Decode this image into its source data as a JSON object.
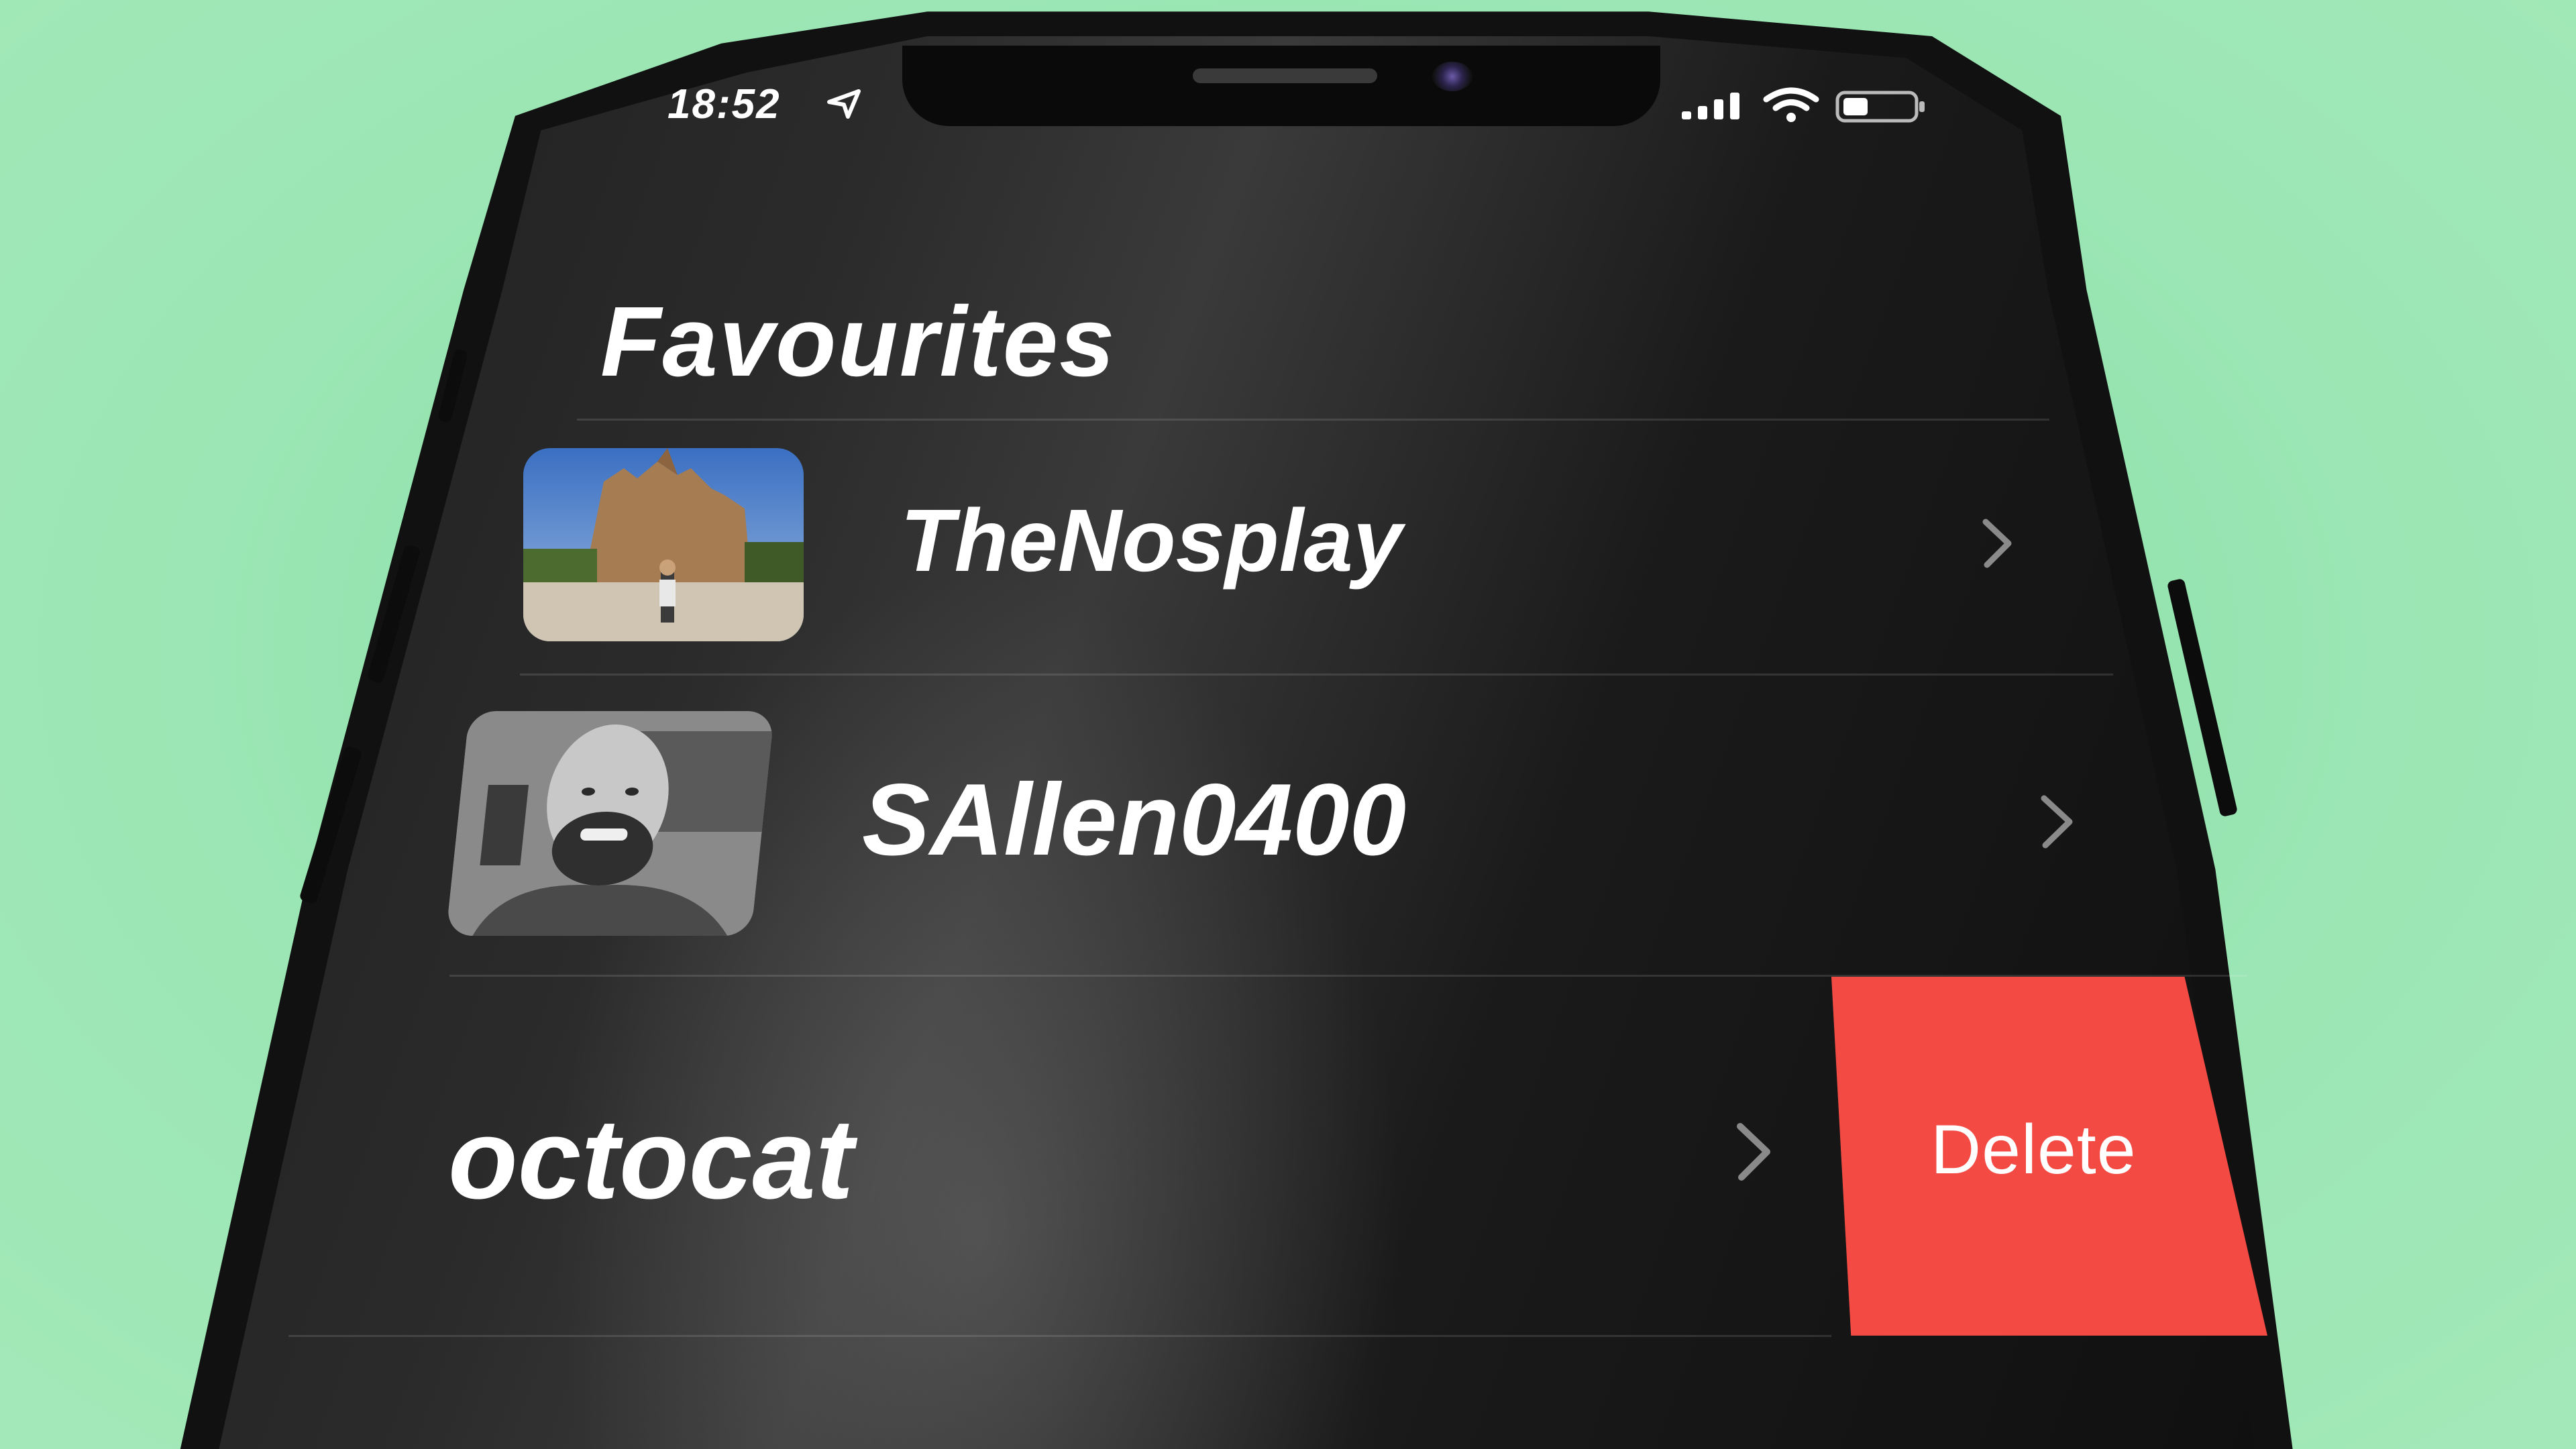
{
  "colors": {
    "background": "#9be6b4",
    "screen": "#1a1a1a",
    "text": "#ffffff",
    "chevron": "#8a8a8a",
    "delete": "#f34b43"
  },
  "status_bar": {
    "time": "18:52",
    "location_icon": "location-arrow-icon",
    "signal_icon": "cellular-signal-icon",
    "wifi_icon": "wifi-icon",
    "battery_icon": "battery-icon"
  },
  "page": {
    "title": "Favourites"
  },
  "favourites": [
    {
      "username": "TheNosplay",
      "avatar": "avatar-photo-cathedral",
      "chevron": "chevron-right-icon"
    },
    {
      "username": "SAllen0400",
      "avatar": "avatar-photo-bearded-man",
      "chevron": "chevron-right-icon"
    },
    {
      "username": "octocat",
      "avatar": "",
      "chevron": "chevron-right-icon"
    }
  ],
  "swipe_action": {
    "label": "Delete"
  }
}
